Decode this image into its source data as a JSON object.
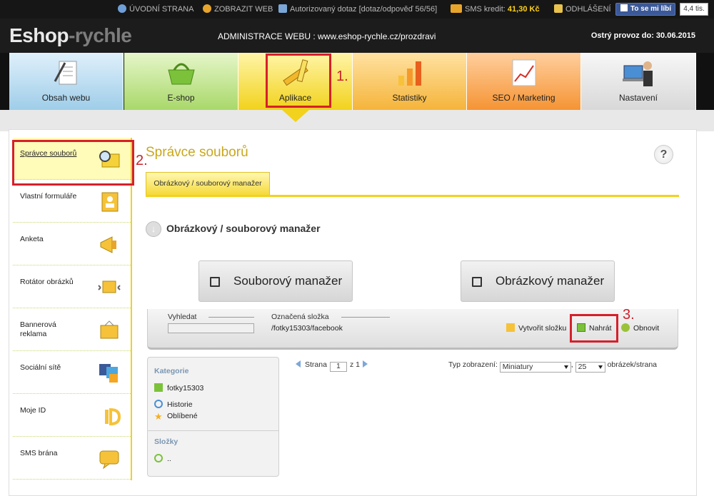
{
  "topbar": {
    "home": "ÚVODNÍ STRANA",
    "show_web": "ZOBRAZIT WEB",
    "query": "Autorizovaný dotaz [dotaz/odpověď 56/56]",
    "sms_label": "SMS kredit:",
    "sms_value": "41,30 Kč",
    "logout": "ODHLÁŠENÍ",
    "like": "To se mi líbí",
    "like_count": "4,4 tis."
  },
  "header": {
    "logo_a": "Eshop",
    "logo_b": "-rychle",
    "admin_title": "ADMINISTRACE WEBU : www.eshop-rychle.cz/prozdravi",
    "ostry": "Ostrý provoz do: 30.06.2015"
  },
  "nav": {
    "tabs": [
      {
        "label": "Obsah webu"
      },
      {
        "label": "E-shop"
      },
      {
        "label": "Aplikace"
      },
      {
        "label": "Statistiky"
      },
      {
        "label": "SEO / Marketing"
      },
      {
        "label": "Nastavení"
      }
    ]
  },
  "annotations": {
    "n1": "1.",
    "n2": "2.",
    "n3": "3."
  },
  "sidebar": {
    "items": [
      {
        "label": "Správce souborů"
      },
      {
        "label": "Vlastní formuláře"
      },
      {
        "label": "Anketa"
      },
      {
        "label": "Rotátor obrázků"
      },
      {
        "label": "Bannerová reklama"
      },
      {
        "label": "Sociální sítě"
      },
      {
        "label": "Moje ID"
      },
      {
        "label": "SMS brána"
      }
    ]
  },
  "content": {
    "title": "Správce souborů",
    "help": "?",
    "tab": "Obrázkový / souborový manažer",
    "section_title": "Obrázkový / souborový manažer",
    "btn_files": "Souborový manažer",
    "btn_images": "Obrázkový manažer"
  },
  "toolbar": {
    "search_label": "Vyhledat",
    "folder_label": "Označená složka",
    "folder_path": "/fotky15303/facebook",
    "create_folder": "Vytvořit složku",
    "upload": "Nahrát",
    "refresh": "Obnovit"
  },
  "categories": {
    "heading": "Kategorie",
    "items": [
      "fotky15303",
      "Historie",
      "Oblíbené"
    ],
    "folders_heading": "Složky",
    "folder_up": ".."
  },
  "pager": {
    "label": "Strana",
    "page": "1",
    "of": "z 1",
    "view_label": "Typ zobrazení:",
    "view_value": "Miniatury",
    "comma": ",",
    "per_page": "25",
    "per_page_label": "obrázek/strana"
  },
  "colors": {
    "accent": "#f2d21c",
    "annotation": "#d6202a",
    "title": "#c9a71d"
  }
}
